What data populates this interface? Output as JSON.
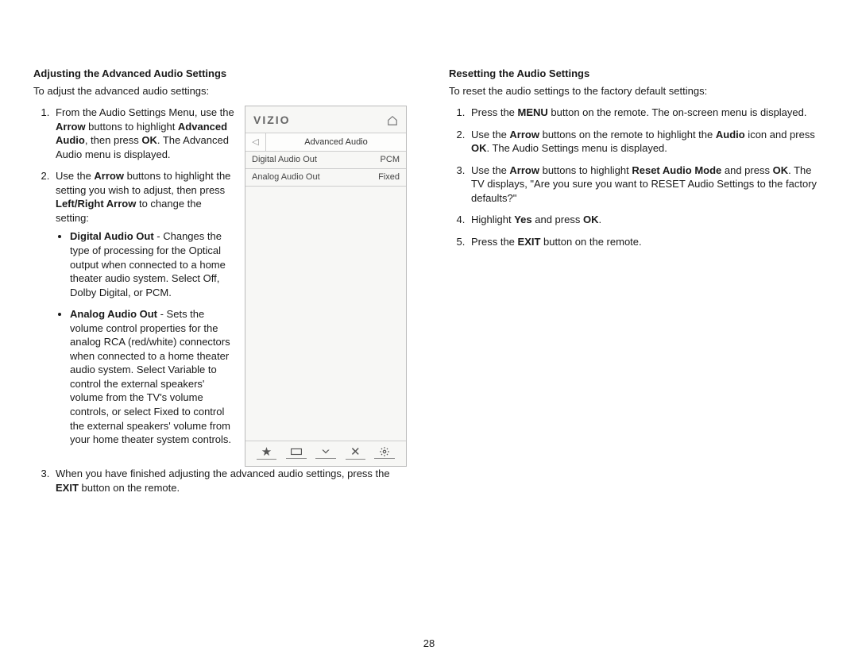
{
  "page_number": "28",
  "left": {
    "heading": "Adjusting the Advanced Audio Settings",
    "intro": "To adjust the advanced audio settings:",
    "step1_a": "From the Audio Settings Menu, use the ",
    "step1_bold1": "Arrow",
    "step1_b": " buttons to highlight ",
    "step1_bold2": "Advanced Audio",
    "step1_c": ", then press ",
    "step1_bold3": "OK",
    "step1_d": ". The Advanced Audio menu is displayed.",
    "step2_a": "Use the ",
    "step2_bold1": "Arrow",
    "step2_b": " buttons to highlight the setting you wish to adjust, then press ",
    "step2_bold2": "Left/Right Arrow",
    "step2_c": " to change the setting:",
    "bullet1_bold": "Digital Audio Out",
    "bullet1_text": " - Changes the type of processing for the Optical output when connected to a home theater audio system. Select Off, Dolby Digital, or PCM.",
    "bullet2_bold": "Analog Audio Out",
    "bullet2_text": " - Sets the volume control properties for the analog RCA (red/white) connectors when connected to a home theater audio system. Select Variable to control the external speakers' volume from the TV's volume controls, or select Fixed to control the external speakers' volume from your home theater system controls.",
    "step3_a": "When you have finished adjusting the advanced audio settings, press the ",
    "step3_bold": "EXIT",
    "step3_b": " button on the remote."
  },
  "right": {
    "heading": "Resetting the Audio Settings",
    "intro": "To reset the audio settings to the factory default settings:",
    "r1_a": "Press the ",
    "r1_bold": "MENU",
    "r1_b": " button on the remote. The on-screen menu is displayed.",
    "r2_a": "Use the ",
    "r2_bold1": "Arrow",
    "r2_b": " buttons on the remote to highlight the ",
    "r2_bold2": "Audio",
    "r2_c": " icon and press ",
    "r2_bold3": "OK",
    "r2_d": ". The Audio Settings menu is displayed.",
    "r3_a": "Use the ",
    "r3_bold1": "Arrow",
    "r3_b": " buttons to highlight ",
    "r3_bold2": "Reset Audio Mode",
    "r3_c": " and press ",
    "r3_bold3": "OK",
    "r3_d": ". The TV displays, \"Are you sure you want to RESET Audio Settings to the factory defaults?\"",
    "r4_a": "Highlight ",
    "r4_bold1": "Yes",
    "r4_b": " and press ",
    "r4_bold2": "OK",
    "r4_c": ".",
    "r5_a": "Press the ",
    "r5_bold": "EXIT",
    "r5_b": " button on the remote."
  },
  "device": {
    "brand": "VIZIO",
    "menu_title": "Advanced Audio",
    "row1_label": "Digital Audio Out",
    "row1_value": "PCM",
    "row2_label": "Analog Audio Out",
    "row2_value": "Fixed"
  }
}
